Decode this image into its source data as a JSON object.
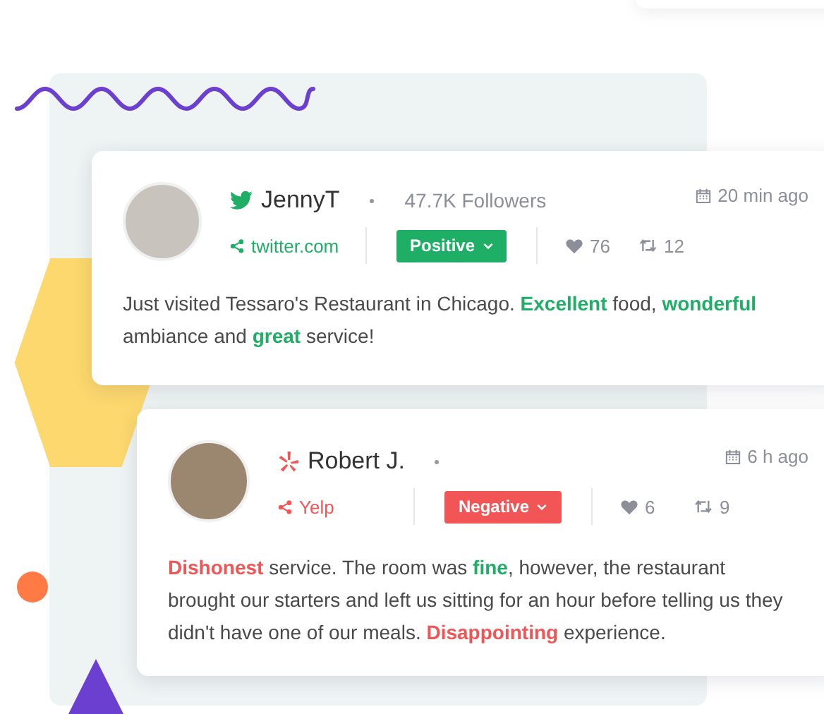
{
  "posts": [
    {
      "kind": "twitter",
      "author": "JennyT",
      "followers": "47.7K Followers",
      "time": "20 min ago",
      "source": "twitter.com",
      "sentiment": {
        "label": "Positive",
        "kind": "positive"
      },
      "likes": "76",
      "shares": "12",
      "text": [
        {
          "text": "Just visited Tessaro's Restaurant in Chicago. ",
          "kind": "plain"
        },
        {
          "text": "Excellent",
          "kind": "positive"
        },
        {
          "text": " food, ",
          "kind": "plain"
        },
        {
          "text": "wonderful",
          "kind": "positive"
        },
        {
          "text": " ambiance and ",
          "kind": "plain"
        },
        {
          "text": "great",
          "kind": "positive"
        },
        {
          "text": " service!",
          "kind": "plain"
        }
      ]
    },
    {
      "kind": "yelp",
      "author": "Robert J.",
      "time": "6 h ago",
      "source": "Yelp",
      "sentiment": {
        "label": "Negative",
        "kind": "negative"
      },
      "likes": "6",
      "shares": "9",
      "text": [
        {
          "text": "Dishonest",
          "kind": "negative"
        },
        {
          "text": " service. The room was ",
          "kind": "plain"
        },
        {
          "text": "fine",
          "kind": "positive"
        },
        {
          "text": ", however, the restaurant brought our starters and left us sitting for an hour before telling us they didn't have one of our meals. ",
          "kind": "plain"
        },
        {
          "text": "Disappointing",
          "kind": "negative"
        },
        {
          "text": " experience.",
          "kind": "plain"
        }
      ]
    }
  ]
}
